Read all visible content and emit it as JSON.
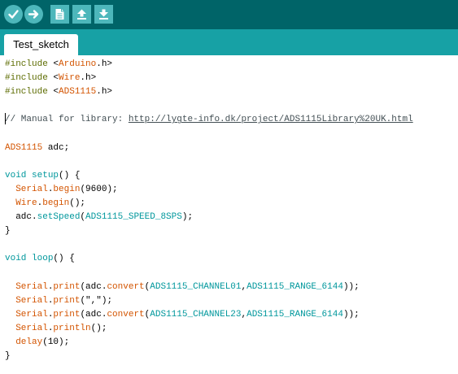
{
  "colors": {
    "toolbar_bg": "#006468",
    "tabbar_bg": "#17a1a5",
    "button_bg": "#4db7bb",
    "keyword": "#5e6d03",
    "type_constant": "#00979c",
    "function": "#d35400",
    "comment": "#434f54"
  },
  "toolbar": {
    "buttons": [
      {
        "name": "verify-icon"
      },
      {
        "name": "upload-icon"
      },
      {
        "name": "new-icon"
      },
      {
        "name": "open-icon"
      },
      {
        "name": "save-icon"
      }
    ]
  },
  "tabs": [
    {
      "label": "Test_sketch"
    }
  ],
  "editor": {
    "lines": [
      [
        {
          "t": "#include",
          "c": "kw"
        },
        {
          "t": " <"
        },
        {
          "t": "Arduino",
          "c": "fn"
        },
        {
          "t": ".h>"
        }
      ],
      [
        {
          "t": "#include",
          "c": "kw"
        },
        {
          "t": " <"
        },
        {
          "t": "Wire",
          "c": "fn"
        },
        {
          "t": ".h>"
        }
      ],
      [
        {
          "t": "#include",
          "c": "kw"
        },
        {
          "t": " <"
        },
        {
          "t": "ADS1115",
          "c": "fn"
        },
        {
          "t": ".h>"
        }
      ],
      [],
      [
        {
          "t": "// Manual for library: ",
          "c": "cm"
        },
        {
          "t": "http://lygte-info.dk/project/ADS1115Library%20UK.html",
          "c": "url"
        }
      ],
      [],
      [
        {
          "t": "ADS1115",
          "c": "fn"
        },
        {
          "t": " adc;"
        }
      ],
      [],
      [
        {
          "t": "void",
          "c": "typ"
        },
        {
          "t": " "
        },
        {
          "t": "setup",
          "c": "typ"
        },
        {
          "t": "() {"
        }
      ],
      [
        {
          "t": "  "
        },
        {
          "t": "Serial",
          "c": "fn"
        },
        {
          "t": "."
        },
        {
          "t": "begin",
          "c": "fn"
        },
        {
          "t": "(9600);"
        }
      ],
      [
        {
          "t": "  "
        },
        {
          "t": "Wire",
          "c": "fn"
        },
        {
          "t": "."
        },
        {
          "t": "begin",
          "c": "fn"
        },
        {
          "t": "();"
        }
      ],
      [
        {
          "t": "  adc."
        },
        {
          "t": "setSpeed",
          "c": "typ"
        },
        {
          "t": "("
        },
        {
          "t": "ADS1115_SPEED_8SPS",
          "c": "typ"
        },
        {
          "t": ");"
        }
      ],
      [
        {
          "t": "}"
        }
      ],
      [],
      [
        {
          "t": "void",
          "c": "typ"
        },
        {
          "t": " "
        },
        {
          "t": "loop",
          "c": "typ"
        },
        {
          "t": "() {"
        }
      ],
      [],
      [
        {
          "t": "  "
        },
        {
          "t": "Serial",
          "c": "fn"
        },
        {
          "t": "."
        },
        {
          "t": "print",
          "c": "fn"
        },
        {
          "t": "(adc."
        },
        {
          "t": "convert",
          "c": "fn"
        },
        {
          "t": "("
        },
        {
          "t": "ADS1115_CHANNEL01",
          "c": "typ"
        },
        {
          "t": ","
        },
        {
          "t": "ADS1115_RANGE_6144",
          "c": "typ"
        },
        {
          "t": "));"
        }
      ],
      [
        {
          "t": "  "
        },
        {
          "t": "Serial",
          "c": "fn"
        },
        {
          "t": "."
        },
        {
          "t": "print",
          "c": "fn"
        },
        {
          "t": "(\",\");"
        }
      ],
      [
        {
          "t": "  "
        },
        {
          "t": "Serial",
          "c": "fn"
        },
        {
          "t": "."
        },
        {
          "t": "print",
          "c": "fn"
        },
        {
          "t": "(adc."
        },
        {
          "t": "convert",
          "c": "fn"
        },
        {
          "t": "("
        },
        {
          "t": "ADS1115_CHANNEL23",
          "c": "typ"
        },
        {
          "t": ","
        },
        {
          "t": "ADS1115_RANGE_6144",
          "c": "typ"
        },
        {
          "t": "));"
        }
      ],
      [
        {
          "t": "  "
        },
        {
          "t": "Serial",
          "c": "fn"
        },
        {
          "t": "."
        },
        {
          "t": "println",
          "c": "fn"
        },
        {
          "t": "();"
        }
      ],
      [
        {
          "t": "  "
        },
        {
          "t": "delay",
          "c": "fn"
        },
        {
          "t": "(10);"
        }
      ],
      [
        {
          "t": "}"
        }
      ]
    ]
  }
}
